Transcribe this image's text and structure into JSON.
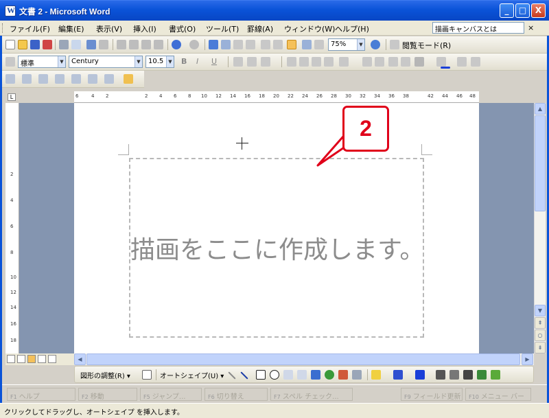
{
  "window": {
    "title": "文書 2 - Microsoft Word",
    "min_label": "_",
    "max_label": "□",
    "close_label": "X"
  },
  "menu": {
    "items": [
      "ファイル(F)",
      "編集(E)",
      "表示(V)",
      "挿入(I)",
      "書式(O)",
      "ツール(T)",
      "罫線(A)",
      "ウィンドウ(W)",
      "ヘルプ(H)"
    ],
    "help_box_value": "描画キャンバスとは",
    "close_glyph": "×"
  },
  "standard_toolbar": {
    "zoom_value": "75%",
    "reading_mode_label": "閲覧モード(R)"
  },
  "formatting_toolbar": {
    "style_value": "標準",
    "font_value": "Century",
    "size_value": "10.5",
    "bold": "B",
    "italic": "I",
    "underline": "U"
  },
  "ruler": {
    "h_numbers": [
      "6",
      "4",
      "2",
      "2",
      "4",
      "6",
      "8",
      "10",
      "12",
      "14",
      "16",
      "18",
      "20",
      "22",
      "24",
      "26",
      "28",
      "30",
      "32",
      "34",
      "36",
      "38",
      "42",
      "44",
      "46",
      "48"
    ],
    "v_numbers": [
      "2",
      "4",
      "6",
      "8",
      "10",
      "12",
      "14",
      "16",
      "18"
    ],
    "tab_marker": "L"
  },
  "document": {
    "canvas_text": "描画をここに作成します。"
  },
  "callout": {
    "number": "2",
    "color": "#e0001a"
  },
  "drawing_toolbar": {
    "draw_menu": "図形の調整(R) ▾",
    "autoshape_menu": "オートシェイプ(U) ▾"
  },
  "function_keys": [
    {
      "key": "F1",
      "label": "ヘルプ"
    },
    {
      "key": "F2",
      "label": "移動"
    },
    {
      "key": "F5",
      "label": "ジャンプ..."
    },
    {
      "key": "F6",
      "label": "切り替え"
    },
    {
      "key": "F7",
      "label": "スペル チェック..."
    },
    {
      "key": "F9",
      "label": "フィールド更新"
    },
    {
      "key": "F10",
      "label": "メニュー バー"
    }
  ],
  "status": {
    "text": "クリックしてドラッグし、オートシェイプ を挿入します。"
  },
  "colors": {
    "title_blue": "#0a53d8",
    "doc_background": "#8495b0"
  }
}
